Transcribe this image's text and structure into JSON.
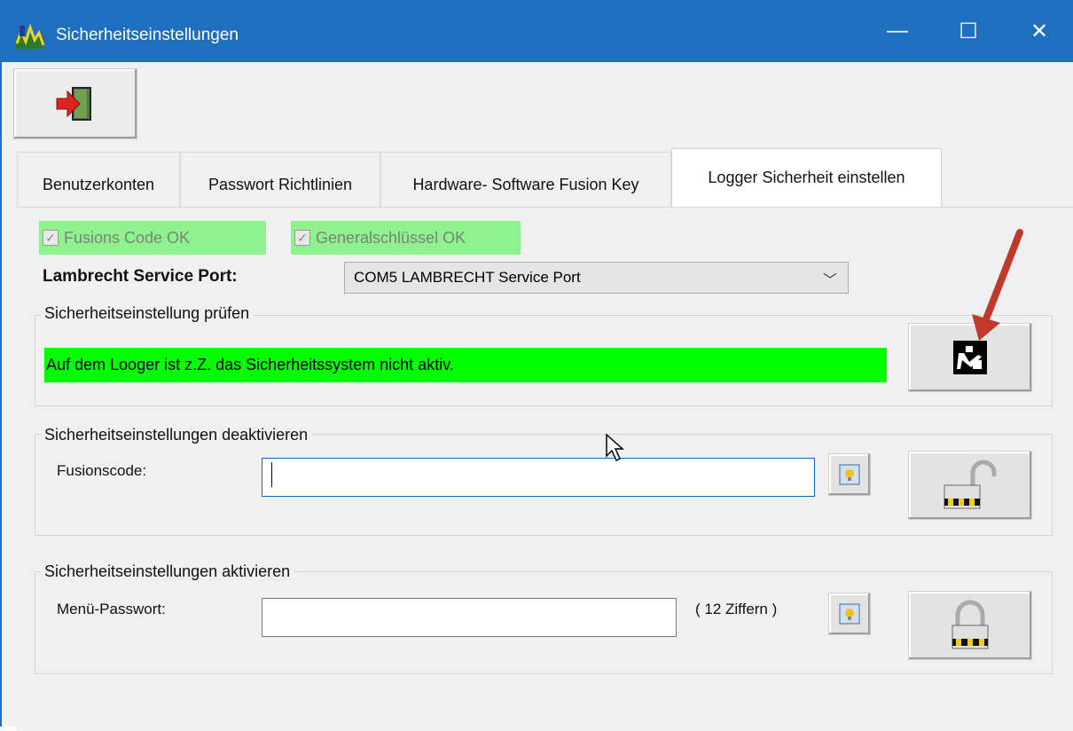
{
  "window": {
    "title": "Sicherheitseinstellungen",
    "minimize_glyph": "—",
    "maximize_glyph": "☐",
    "close_glyph": "✕"
  },
  "toolbar": {
    "exit_icon": "exit-door-icon"
  },
  "tabs": [
    {
      "label": "Benutzerkonten",
      "active": false
    },
    {
      "label": "Passwort Richtlinien",
      "active": false
    },
    {
      "label": "Hardware- Software Fusion Key",
      "active": false
    },
    {
      "label": "Logger Sicherheit einstellen",
      "active": true
    }
  ],
  "checks": {
    "fusion_code": {
      "label": "Fusions Code  OK",
      "checked": true
    },
    "general_key": {
      "label": "Generalschlüssel OK",
      "checked": true
    }
  },
  "port": {
    "label": "Lambrecht Service  Port:",
    "selected": "COM5  LAMBRECHT Service Port"
  },
  "check_group": {
    "title": "Sicherheitseinstellung prüfen",
    "status": "Auf dem Looger ist z.Z. das Sicherheitssystem nicht aktiv.",
    "status_color": "#00ff00"
  },
  "deactivate_group": {
    "title": "Sicherheitseinstellungen deaktivieren",
    "field_label": "Fusionscode:",
    "field_value": ""
  },
  "activate_group": {
    "title": "Sicherheitseinstellungen aktivieren",
    "field_label": "Menü-Passwort:",
    "field_value": "",
    "hint": "( 12 Ziffern )"
  },
  "colors": {
    "titlebar": "#1e6fbf",
    "ok_background": "#8ef38e",
    "annotation_arrow": "#c0392b"
  }
}
